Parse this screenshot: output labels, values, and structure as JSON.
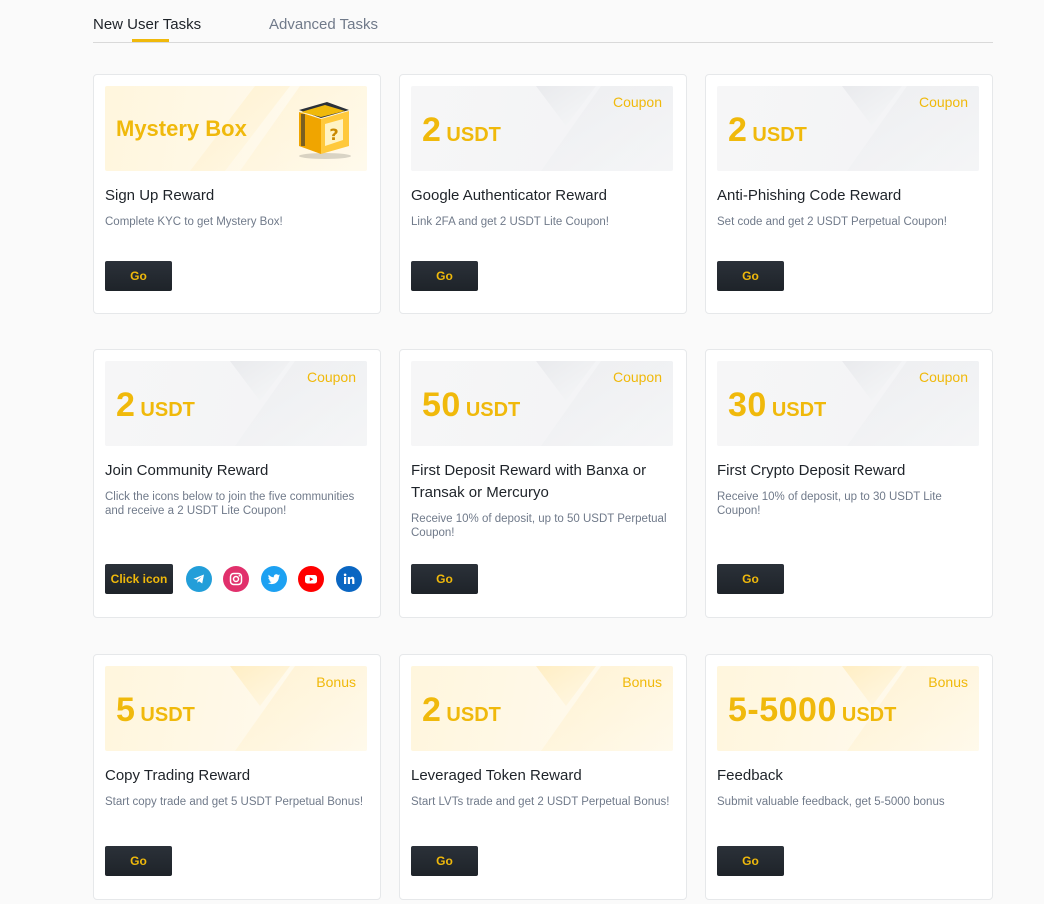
{
  "tabs": [
    {
      "label": "New User Tasks"
    },
    {
      "label": "Advanced Tasks"
    }
  ],
  "colors": {
    "accent": "#f0b90b",
    "button_bg": "#1e2329",
    "telegram": "#229ed9",
    "instagram": "#e1306c",
    "twitter": "#1da1f2",
    "youtube": "#ff0000",
    "linkedin": "#0a66c2"
  },
  "cards": [
    {
      "banner_kind": "mystery",
      "banner_text": "Mystery Box",
      "title": "Sign Up Reward",
      "desc": "Complete KYC to get Mystery Box!",
      "button": "Go"
    },
    {
      "banner_kind": "coupon",
      "type_label": "Coupon",
      "amount": "2",
      "unit": "USDT",
      "title": "Google Authenticator Reward",
      "desc": "Link 2FA and get 2 USDT Lite Coupon!",
      "button": "Go"
    },
    {
      "banner_kind": "coupon",
      "type_label": "Coupon",
      "amount": "2",
      "unit": "USDT",
      "title": "Anti-Phishing Code Reward",
      "desc": "Set code and get 2 USDT Perpetual Coupon!",
      "button": "Go"
    },
    {
      "banner_kind": "coupon",
      "type_label": "Coupon",
      "amount": "2",
      "unit": "USDT",
      "title": "Join Community Reward",
      "desc": "Click the icons below to join the five communities and receive a 2 USDT Lite Coupon!",
      "button": "Click icon",
      "socials": [
        "telegram-icon",
        "instagram-icon",
        "twitter-icon",
        "youtube-icon",
        "linkedin-icon"
      ]
    },
    {
      "banner_kind": "coupon",
      "type_label": "Coupon",
      "amount": "50",
      "unit": "USDT",
      "title": "First Deposit Reward with Banxa or Transak or Mercuryo",
      "desc": "Receive 10% of deposit, up to 50 USDT Perpetual Coupon!",
      "button": "Go"
    },
    {
      "banner_kind": "coupon",
      "type_label": "Coupon",
      "amount": "30",
      "unit": "USDT",
      "title": "First Crypto Deposit Reward",
      "desc": "Receive 10% of deposit, up to 30 USDT Lite Coupon!",
      "button": "Go"
    },
    {
      "banner_kind": "bonus",
      "type_label": "Bonus",
      "amount": "5",
      "unit": "USDT",
      "title": "Copy Trading Reward",
      "desc": "Start copy trade and get 5 USDT Perpetual Bonus!",
      "button": "Go"
    },
    {
      "banner_kind": "bonus",
      "type_label": "Bonus",
      "amount": "2",
      "unit": "USDT",
      "title": "Leveraged Token Reward",
      "desc": "Start LVTs trade and get 2 USDT Perpetual Bonus!",
      "button": "Go"
    },
    {
      "banner_kind": "bonus",
      "type_label": "Bonus",
      "amount": "5-5000",
      "unit": "USDT",
      "title": "Feedback",
      "desc": "Submit valuable feedback, get 5-5000 bonus",
      "button": "Go"
    }
  ]
}
